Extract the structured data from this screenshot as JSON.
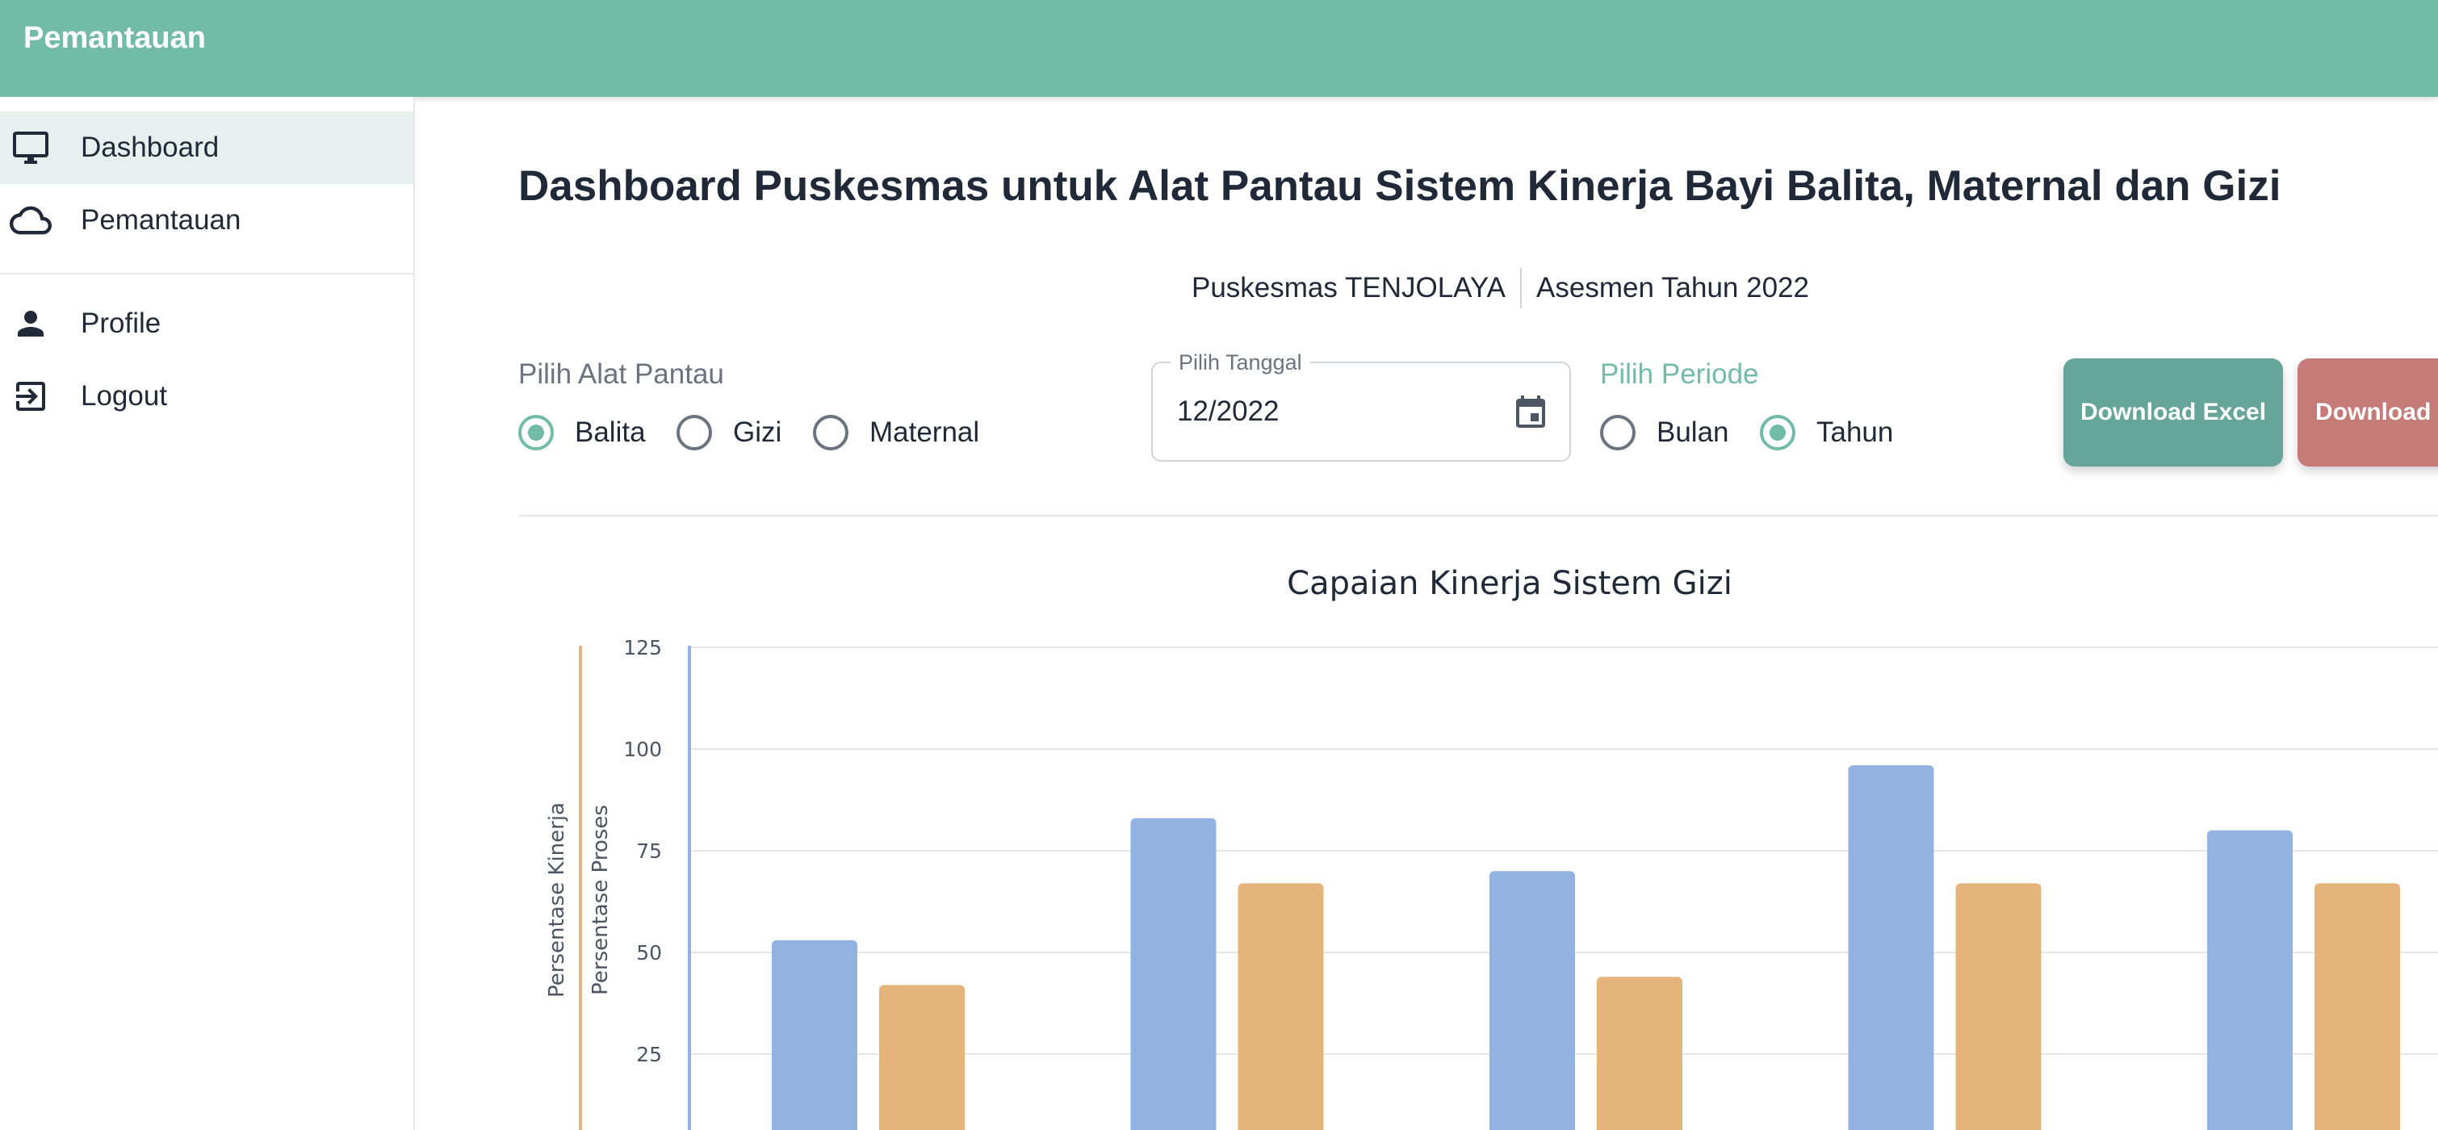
{
  "header": {
    "title": "Pemantauan"
  },
  "sidebar": {
    "items": [
      {
        "label": "Dashboard",
        "icon": "monitor-icon",
        "active": true
      },
      {
        "label": "Pemantauan",
        "icon": "cloud-icon",
        "active": false
      },
      {
        "label": "Profile",
        "icon": "person-icon",
        "active": false
      },
      {
        "label": "Logout",
        "icon": "logout-icon",
        "active": false
      }
    ]
  },
  "main": {
    "title": "Dashboard Puskesmas untuk Alat Pantau Sistem Kinerja Bayi Balita, Maternal dan Gizi",
    "puskesmas": "Puskesmas TENJOLAYA",
    "asesmen": "Asesmen Tahun 2022"
  },
  "filters": {
    "alat_pantau": {
      "label": "Pilih Alat Pantau",
      "options": [
        "Balita",
        "Gizi",
        "Maternal"
      ],
      "selected": "Balita"
    },
    "tanggal": {
      "label": "Pilih Tanggal",
      "value": "12/2022"
    },
    "periode": {
      "label": "Pilih Periode",
      "options": [
        "Bulan",
        "Tahun"
      ],
      "selected": "Tahun"
    }
  },
  "buttons": {
    "excel": "Download Excel",
    "pdf": "Download PDF"
  },
  "colors": {
    "primary": "#71bba7",
    "excel_button": "#65a59a",
    "pdf_button": "#c77b78",
    "series_kinerja": "#92b2e2",
    "series_proses": "#e4b47b"
  },
  "chart_data": {
    "type": "bar",
    "title": "Capaian Kinerja Sistem Gizi",
    "ylabel_left": "Persentase Kinerja",
    "ylabel_right": "Persentase Proses",
    "yticks": [
      25,
      50,
      75,
      100,
      125
    ],
    "ylim": [
      0,
      125
    ],
    "grid": true,
    "series": [
      {
        "values": [
          53,
          83,
          70,
          96,
          80
        ]
      },
      {
        "values": [
          42,
          67,
          44,
          67,
          67
        ]
      }
    ]
  }
}
